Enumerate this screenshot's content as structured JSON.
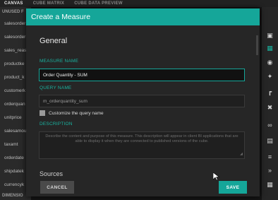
{
  "tabs": [
    "CANVAS",
    "CUBE MATRIX",
    "CUBE DATA PREVIEW"
  ],
  "left_panel": {
    "header": "UNUSED F",
    "fields": [
      "salesorder",
      "salesorder",
      "sales_reas",
      "productke",
      "product_k",
      "customerk",
      "orderquan",
      "unitprice",
      "salesamou",
      "taxamt",
      "orderdate",
      "shipdatek",
      "currencyk"
    ],
    "footer_header": "DIMENSIO"
  },
  "dialog": {
    "title": "Create a Measure",
    "section_general": "General",
    "measure_name_label": "MEASURE NAME",
    "measure_name_value": "Order Quantity - SUM",
    "query_name_label": "QUERY NAME",
    "query_name_value": "m_orderquantity_sum",
    "customize_label": "Customize the query name",
    "description_label": "DESCRIPTION",
    "description_placeholder": "Describe the content and purpose of this measure. This description will appear in client BI applications that are able to display it when they are connected to published versions of the cube.",
    "next_section": "Sources",
    "cancel_label": "CANCEL",
    "save_label": "SAVE"
  },
  "toolbar_icons": [
    "cube-icon",
    "table-icon",
    "eye-icon",
    "wand-icon",
    "crop-icon",
    "tool-icon",
    "binoculars-icon",
    "book-icon",
    "stack-icon",
    "calendar-icon",
    "chevrons-down-icon"
  ],
  "colors": {
    "accent": "#15a699",
    "dialog_bg": "#262626"
  }
}
